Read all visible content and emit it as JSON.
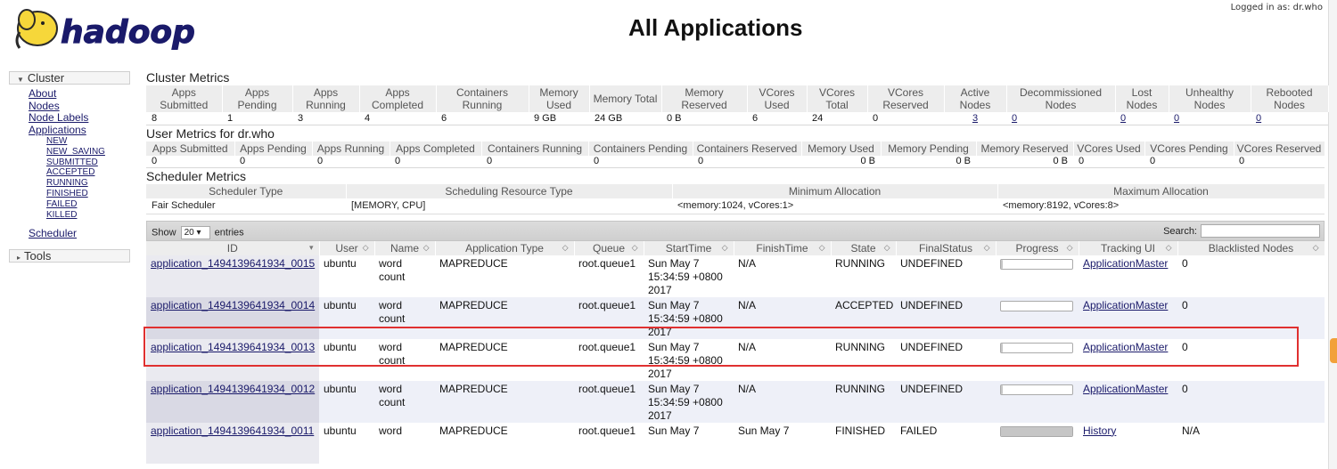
{
  "header": {
    "title": "All Applications",
    "logged_in": "Logged in as: dr.who",
    "logo_text": "hadoop"
  },
  "nav": {
    "cluster_label": "Cluster",
    "cluster_links": [
      "About",
      "Nodes",
      "Node Labels",
      "Applications"
    ],
    "app_states": [
      "NEW",
      "NEW_SAVING",
      "SUBMITTED",
      "ACCEPTED",
      "RUNNING",
      "FINISHED",
      "FAILED",
      "KILLED"
    ],
    "scheduler": "Scheduler",
    "tools_label": "Tools"
  },
  "cluster_metrics": {
    "title": "Cluster Metrics",
    "headers": [
      "Apps Submitted",
      "Apps Pending",
      "Apps Running",
      "Apps Completed",
      "Containers Running",
      "Memory Used",
      "Memory Total",
      "Memory Reserved",
      "VCores Used",
      "VCores Total",
      "VCores Reserved",
      "Active Nodes",
      "Decommissioned Nodes",
      "Lost Nodes",
      "Unhealthy Nodes",
      "Rebooted Nodes"
    ],
    "values": [
      "8",
      "1",
      "3",
      "4",
      "6",
      "9 GB",
      "24 GB",
      "0 B",
      "6",
      "24",
      "0",
      "3",
      "0",
      "0",
      "0",
      "0"
    ]
  },
  "user_metrics": {
    "title": "User Metrics for dr.who",
    "headers": [
      "Apps Submitted",
      "Apps Pending",
      "Apps Running",
      "Apps Completed",
      "Containers Running",
      "Containers Pending",
      "Containers Reserved",
      "Memory Used",
      "Memory Pending",
      "Memory Reserved",
      "VCores Used",
      "VCores Pending",
      "VCores Reserved"
    ],
    "values": [
      "0",
      "0",
      "0",
      "0",
      "0",
      "0",
      "0",
      "0 B",
      "0 B",
      "0 B",
      "0",
      "0",
      "0"
    ]
  },
  "scheduler_metrics": {
    "title": "Scheduler Metrics",
    "headers": [
      "Scheduler Type",
      "Scheduling Resource Type",
      "Minimum Allocation",
      "Maximum Allocation"
    ],
    "values": [
      "Fair Scheduler",
      "[MEMORY, CPU]",
      "<memory:1024, vCores:1>",
      "<memory:8192, vCores:8>"
    ]
  },
  "table_controls": {
    "show": "Show",
    "entries_value": "20",
    "entries": "entries",
    "search": "Search:"
  },
  "apps": {
    "headers": [
      "ID",
      "User",
      "Name",
      "Application Type",
      "Queue",
      "StartTime",
      "FinishTime",
      "State",
      "FinalStatus",
      "Progress",
      "Tracking UI",
      "Blacklisted Nodes"
    ],
    "rows": [
      {
        "id": "application_1494139641934_0015",
        "user": "ubuntu",
        "name": "word count",
        "type": "MAPREDUCE",
        "queue": "root.queue1",
        "start": "Sun May 7 15:34:59 +0800 2017",
        "finish": "N/A",
        "state": "RUNNING",
        "final": "UNDEFINED",
        "progress": 0.02,
        "tracking": "ApplicationMaster",
        "blacklisted": "0"
      },
      {
        "id": "application_1494139641934_0014",
        "user": "ubuntu",
        "name": "word count",
        "type": "MAPREDUCE",
        "queue": "root.queue1",
        "start": "Sun May 7 15:34:59 +0800 2017",
        "finish": "N/A",
        "state": "ACCEPTED",
        "final": "UNDEFINED",
        "progress": 0.0,
        "tracking": "ApplicationMaster",
        "blacklisted": "0"
      },
      {
        "id": "application_1494139641934_0013",
        "user": "ubuntu",
        "name": "word count",
        "type": "MAPREDUCE",
        "queue": "root.queue1",
        "start": "Sun May 7 15:34:59 +0800 2017",
        "finish": "N/A",
        "state": "RUNNING",
        "final": "UNDEFINED",
        "progress": 0.02,
        "tracking": "ApplicationMaster",
        "blacklisted": "0"
      },
      {
        "id": "application_1494139641934_0012",
        "user": "ubuntu",
        "name": "word count",
        "type": "MAPREDUCE",
        "queue": "root.queue1",
        "start": "Sun May 7 15:34:59 +0800 2017",
        "finish": "N/A",
        "state": "RUNNING",
        "final": "UNDEFINED",
        "progress": 0.02,
        "tracking": "ApplicationMaster",
        "blacklisted": "0"
      },
      {
        "id": "application_1494139641934_0011",
        "user": "ubuntu",
        "name": "word",
        "type": "MAPREDUCE",
        "queue": "root.queue1",
        "start": "Sun May 7",
        "finish": "Sun May 7",
        "state": "FINISHED",
        "final": "FAILED",
        "progress": 1.0,
        "tracking": "History",
        "blacklisted": "N/A"
      }
    ]
  }
}
